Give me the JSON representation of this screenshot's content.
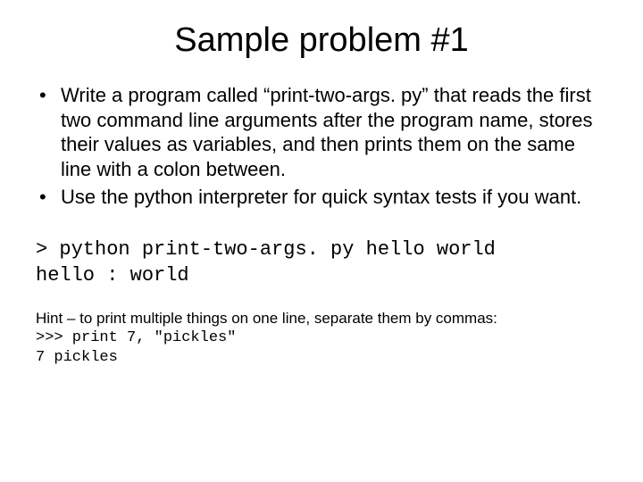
{
  "title": "Sample problem #1",
  "bullets": [
    "Write a program called “print-two-args. py” that reads the first two command line arguments after the program name, stores their values as variables, and then prints them on the same line with a colon between.",
    "Use the python interpreter for quick syntax tests if you want."
  ],
  "code": {
    "line1": "> python print-two-args. py hello world",
    "line2": "hello : world"
  },
  "hint": {
    "intro": "Hint – to print multiple things on one line, separate them by commas:",
    "code1": ">>> print 7, \"pickles\"",
    "code2": "7 pickles"
  }
}
